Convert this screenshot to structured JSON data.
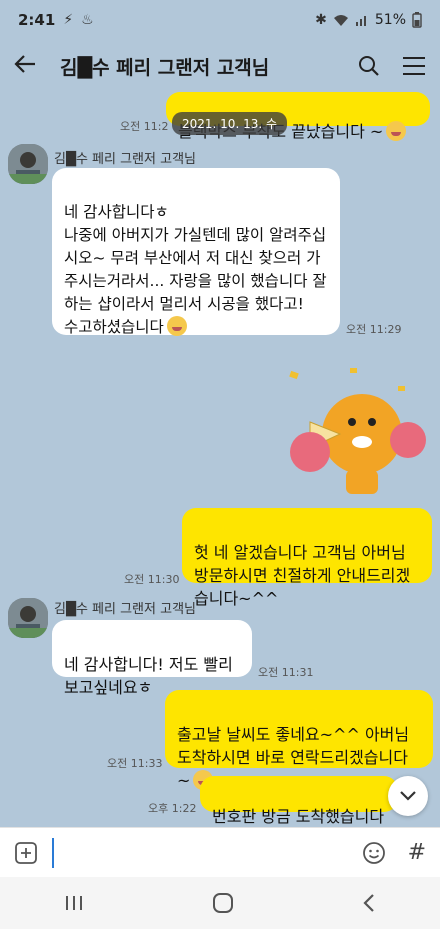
{
  "status_bar": {
    "time": "2:41",
    "battery": "51%"
  },
  "header": {
    "title": "김█수 페리 그랜저 고객님"
  },
  "date_pill": "2021. 10. 13. 수",
  "messages": [
    {
      "from": "me",
      "text": "블랙박스 부착도 끝났습니다 ~",
      "time": "오전 11:2"
    },
    {
      "from": "other",
      "sender": "김█수 페리 그랜저 고객님",
      "text": "네 감사합니다ㅎ\n나중에 아버지가 가실텐데 많이 알려주십시오~  무려 부산에서 저 대신 찾으러 가주시는거라서...  자랑을 많이 했습니다 잘하는 샵이라서 멀리서 시공을 했다고!\n수고하셨습니다",
      "time": "오전 11:29"
    },
    {
      "from": "other",
      "sticker": "cheering-lion-sticker"
    },
    {
      "from": "me",
      "text": "헛 네 알겠습니다 고객님 아버님 방문하시면 친절하게 안내드리겠습니다~^^",
      "time": "오전 11:30"
    },
    {
      "from": "other",
      "sender": "김█수 페리 그랜저 고객님",
      "text": "네 감사합니다! 저도 빨리 보고싶네요ㅎ",
      "time": "오전 11:31"
    },
    {
      "from": "me",
      "text": "출고날 날씨도 좋네요~^^ 아버님 도착하시면 바로 연락드리겠습니다 ~",
      "time": "오전 11:33"
    },
    {
      "from": "me",
      "text": "번호판 방금 도착했습니다",
      "time": "오후 1:22"
    }
  ],
  "input": {
    "placeholder": ""
  },
  "hash_label": "#",
  "icons": {
    "back": "back-arrow-icon",
    "search": "search-icon",
    "menu": "hamburger-menu-icon",
    "attach": "plus-square-icon",
    "emoji": "emoji-icon",
    "scroll_down": "chevron-down-icon"
  },
  "colors": {
    "chat_bg": "#b2c7d9",
    "my_bubble": "#fee500",
    "other_bubble": "#ffffff"
  }
}
